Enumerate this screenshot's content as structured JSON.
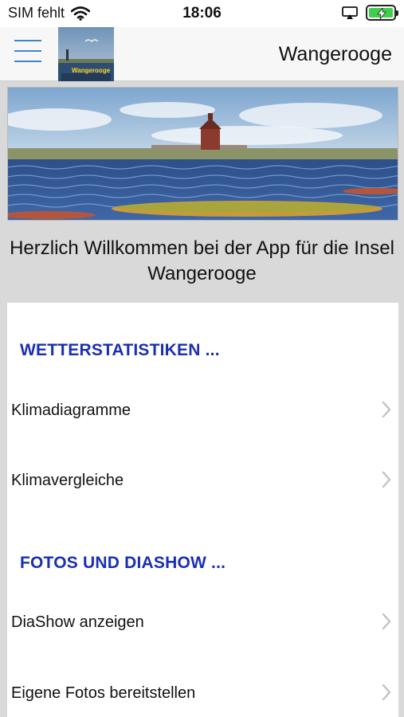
{
  "status_bar": {
    "carrier": "SIM fehlt",
    "time": "18:06"
  },
  "nav": {
    "title": "Wangerooge",
    "logo_caption": "Wangerooge"
  },
  "welcome_text": "Herzlich Willkommen bei der App für die Insel Wangerooge",
  "sections": [
    {
      "header": "WETTERSTATISTIKEN ...",
      "items": [
        "Klimadiagramme",
        "Klimavergleiche"
      ]
    },
    {
      "header": "FOTOS UND DIASHOW ...",
      "items": [
        "DiaShow anzeigen",
        "Eigene Fotos bereitstellen"
      ]
    }
  ],
  "colors": {
    "accent": "#3d88c4",
    "section_header": "#1a2fb3",
    "battery": "#3fcf4a"
  }
}
